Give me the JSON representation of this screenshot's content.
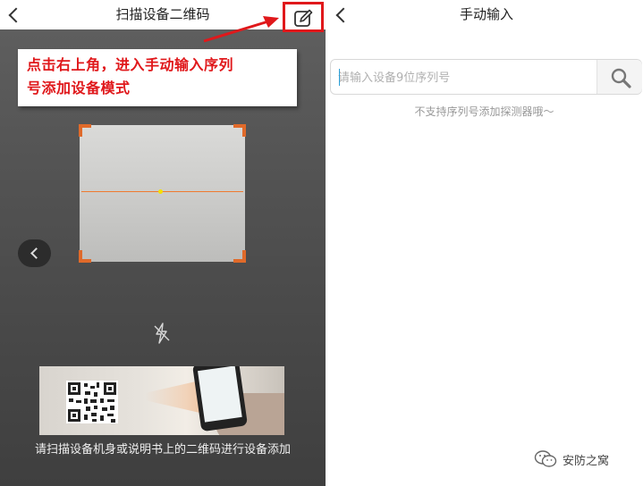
{
  "scan_screen": {
    "title": "扫描设备二维码",
    "annotation_line1": "点击右上角，进入手动输入序列",
    "annotation_line2": "号添加设备模式",
    "hint": "请扫描设备机身或说明书上的二维码进行设备添加",
    "colors": {
      "annotation_red": "#e0181b",
      "corner_orange": "#e06a2a"
    },
    "icons": [
      "back-icon",
      "edit-icon",
      "flash-off-icon",
      "side-back-icon"
    ]
  },
  "manual_screen": {
    "title": "手动输入",
    "input_placeholder": "请输入设备9位序列号",
    "input_value": "",
    "no_support_text": "不支持序列号添加探测器哦～",
    "icons": [
      "back-icon",
      "search-icon"
    ]
  },
  "watermark": {
    "text": "安防之窝"
  }
}
